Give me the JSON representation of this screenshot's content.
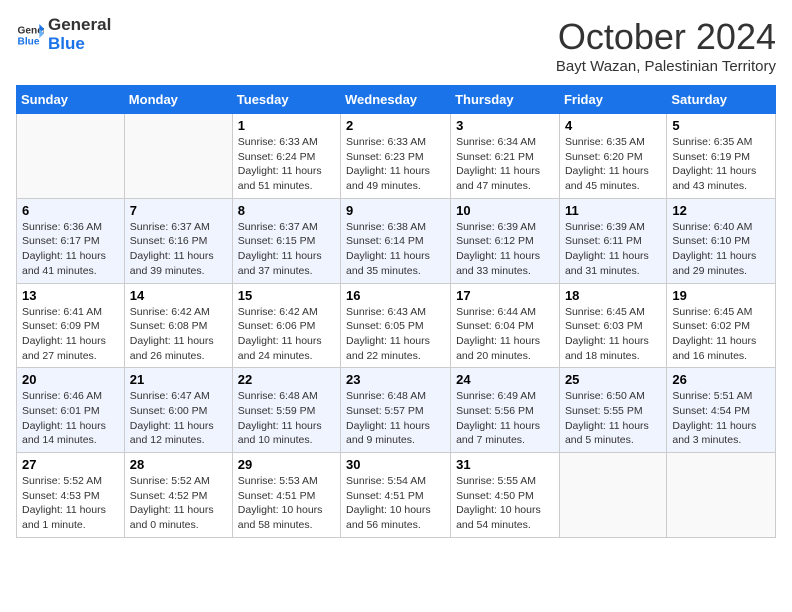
{
  "header": {
    "logo_general": "General",
    "logo_blue": "Blue",
    "title": "October 2024",
    "subtitle": "Bayt Wazan, Palestinian Territory"
  },
  "weekdays": [
    "Sunday",
    "Monday",
    "Tuesday",
    "Wednesday",
    "Thursday",
    "Friday",
    "Saturday"
  ],
  "weeks": [
    [
      {
        "day": "",
        "info": ""
      },
      {
        "day": "",
        "info": ""
      },
      {
        "day": "1",
        "info": "Sunrise: 6:33 AM\nSunset: 6:24 PM\nDaylight: 11 hours and 51 minutes."
      },
      {
        "day": "2",
        "info": "Sunrise: 6:33 AM\nSunset: 6:23 PM\nDaylight: 11 hours and 49 minutes."
      },
      {
        "day": "3",
        "info": "Sunrise: 6:34 AM\nSunset: 6:21 PM\nDaylight: 11 hours and 47 minutes."
      },
      {
        "day": "4",
        "info": "Sunrise: 6:35 AM\nSunset: 6:20 PM\nDaylight: 11 hours and 45 minutes."
      },
      {
        "day": "5",
        "info": "Sunrise: 6:35 AM\nSunset: 6:19 PM\nDaylight: 11 hours and 43 minutes."
      }
    ],
    [
      {
        "day": "6",
        "info": "Sunrise: 6:36 AM\nSunset: 6:17 PM\nDaylight: 11 hours and 41 minutes."
      },
      {
        "day": "7",
        "info": "Sunrise: 6:37 AM\nSunset: 6:16 PM\nDaylight: 11 hours and 39 minutes."
      },
      {
        "day": "8",
        "info": "Sunrise: 6:37 AM\nSunset: 6:15 PM\nDaylight: 11 hours and 37 minutes."
      },
      {
        "day": "9",
        "info": "Sunrise: 6:38 AM\nSunset: 6:14 PM\nDaylight: 11 hours and 35 minutes."
      },
      {
        "day": "10",
        "info": "Sunrise: 6:39 AM\nSunset: 6:12 PM\nDaylight: 11 hours and 33 minutes."
      },
      {
        "day": "11",
        "info": "Sunrise: 6:39 AM\nSunset: 6:11 PM\nDaylight: 11 hours and 31 minutes."
      },
      {
        "day": "12",
        "info": "Sunrise: 6:40 AM\nSunset: 6:10 PM\nDaylight: 11 hours and 29 minutes."
      }
    ],
    [
      {
        "day": "13",
        "info": "Sunrise: 6:41 AM\nSunset: 6:09 PM\nDaylight: 11 hours and 27 minutes."
      },
      {
        "day": "14",
        "info": "Sunrise: 6:42 AM\nSunset: 6:08 PM\nDaylight: 11 hours and 26 minutes."
      },
      {
        "day": "15",
        "info": "Sunrise: 6:42 AM\nSunset: 6:06 PM\nDaylight: 11 hours and 24 minutes."
      },
      {
        "day": "16",
        "info": "Sunrise: 6:43 AM\nSunset: 6:05 PM\nDaylight: 11 hours and 22 minutes."
      },
      {
        "day": "17",
        "info": "Sunrise: 6:44 AM\nSunset: 6:04 PM\nDaylight: 11 hours and 20 minutes."
      },
      {
        "day": "18",
        "info": "Sunrise: 6:45 AM\nSunset: 6:03 PM\nDaylight: 11 hours and 18 minutes."
      },
      {
        "day": "19",
        "info": "Sunrise: 6:45 AM\nSunset: 6:02 PM\nDaylight: 11 hours and 16 minutes."
      }
    ],
    [
      {
        "day": "20",
        "info": "Sunrise: 6:46 AM\nSunset: 6:01 PM\nDaylight: 11 hours and 14 minutes."
      },
      {
        "day": "21",
        "info": "Sunrise: 6:47 AM\nSunset: 6:00 PM\nDaylight: 11 hours and 12 minutes."
      },
      {
        "day": "22",
        "info": "Sunrise: 6:48 AM\nSunset: 5:59 PM\nDaylight: 11 hours and 10 minutes."
      },
      {
        "day": "23",
        "info": "Sunrise: 6:48 AM\nSunset: 5:57 PM\nDaylight: 11 hours and 9 minutes."
      },
      {
        "day": "24",
        "info": "Sunrise: 6:49 AM\nSunset: 5:56 PM\nDaylight: 11 hours and 7 minutes."
      },
      {
        "day": "25",
        "info": "Sunrise: 6:50 AM\nSunset: 5:55 PM\nDaylight: 11 hours and 5 minutes."
      },
      {
        "day": "26",
        "info": "Sunrise: 5:51 AM\nSunset: 4:54 PM\nDaylight: 11 hours and 3 minutes."
      }
    ],
    [
      {
        "day": "27",
        "info": "Sunrise: 5:52 AM\nSunset: 4:53 PM\nDaylight: 11 hours and 1 minute."
      },
      {
        "day": "28",
        "info": "Sunrise: 5:52 AM\nSunset: 4:52 PM\nDaylight: 11 hours and 0 minutes."
      },
      {
        "day": "29",
        "info": "Sunrise: 5:53 AM\nSunset: 4:51 PM\nDaylight: 10 hours and 58 minutes."
      },
      {
        "day": "30",
        "info": "Sunrise: 5:54 AM\nSunset: 4:51 PM\nDaylight: 10 hours and 56 minutes."
      },
      {
        "day": "31",
        "info": "Sunrise: 5:55 AM\nSunset: 4:50 PM\nDaylight: 10 hours and 54 minutes."
      },
      {
        "day": "",
        "info": ""
      },
      {
        "day": "",
        "info": ""
      }
    ]
  ]
}
